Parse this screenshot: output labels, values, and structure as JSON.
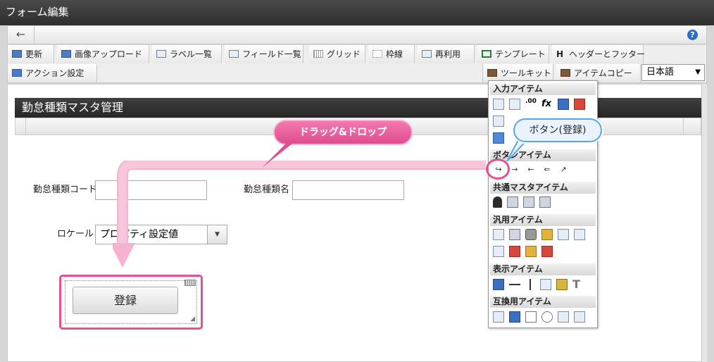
{
  "window": {
    "title": "フォーム編集"
  },
  "nav": {
    "back_icon": "←",
    "help_icon": "?"
  },
  "toolbar": {
    "row1": [
      {
        "label": "更新",
        "icon": "refresh-icon"
      },
      {
        "label": "画像アップロード",
        "icon": "image-upload-icon"
      },
      {
        "label": "ラベル一覧",
        "icon": "label-list-icon"
      },
      {
        "label": "フィールド一覧",
        "icon": "field-list-icon"
      },
      {
        "label": "グリッド",
        "icon": "grid-icon"
      },
      {
        "label": "枠線",
        "icon": "border-icon"
      },
      {
        "label": "再利用",
        "icon": "reuse-icon"
      },
      {
        "label": "テンプレート",
        "icon": "template-icon"
      },
      {
        "label": "ヘッダーとフッター",
        "icon": "header-footer-icon"
      }
    ],
    "row2": [
      {
        "label": "アクション設定",
        "icon": "action-icon"
      },
      {
        "label": "ツールキット",
        "icon": "toolkit-icon"
      },
      {
        "label": "アイテムコピー",
        "icon": "item-copy-icon"
      }
    ],
    "language": "日本語",
    "header_footer_glyph": "H"
  },
  "form": {
    "title": "勤怠種類マスタ管理",
    "fields": {
      "code_label": "勤怠種類コード",
      "name_label": "勤怠種類名",
      "locale_label": "ロケール",
      "locale_value": "プロパティ設定値"
    },
    "register_button": "登録"
  },
  "palette": {
    "sections": {
      "input": "入力アイテム",
      "button": "ボタンアイテム",
      "common_master": "共通マスタアイテム",
      "general": "汎用アイテム",
      "display": "表示アイテム",
      "compat": "互換用アイテム"
    },
    "fx": "fx",
    "num": ".00",
    "text_icon": "T"
  },
  "callouts": {
    "drag_drop": "ドラッグ&ドロップ",
    "button_register": "ボタン(登録)"
  },
  "colors": {
    "accent_pink": "#e64f91",
    "callout_blue": "#5aa4e6",
    "header_dark": "#2e2e2e"
  }
}
